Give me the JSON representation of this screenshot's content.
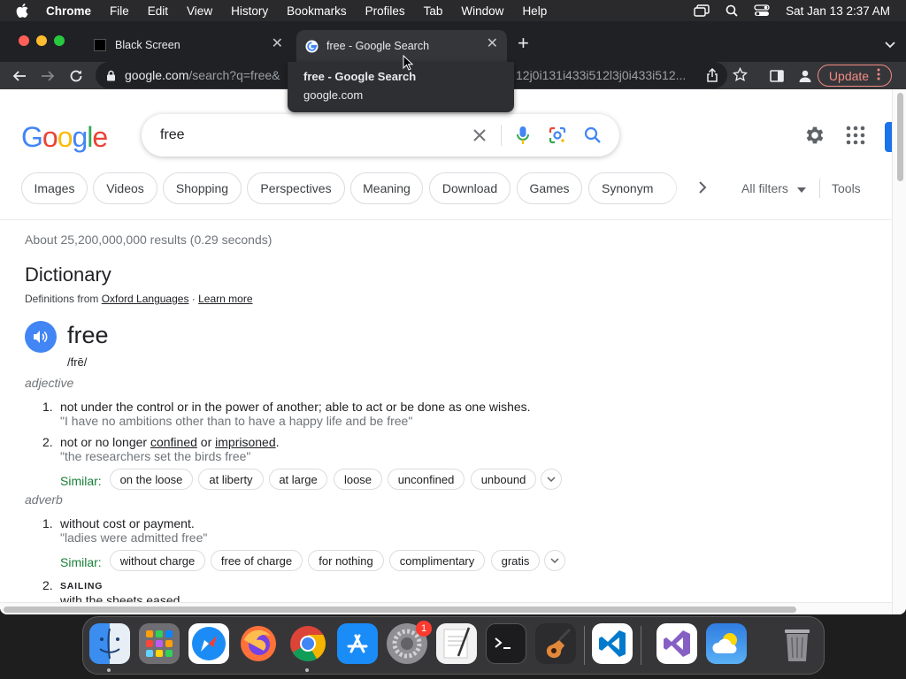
{
  "menubar": {
    "app": "Chrome",
    "items": [
      "File",
      "Edit",
      "View",
      "History",
      "Bookmarks",
      "Profiles",
      "Tab",
      "Window",
      "Help"
    ],
    "clock": "Sat Jan 13  2:37 AM"
  },
  "tabs": [
    {
      "title": "Black Screen",
      "active": false
    },
    {
      "title": "free - Google Search",
      "active": true
    }
  ],
  "toolbar": {
    "url_host": "google.com",
    "url_rest": "/search?q=free&",
    "url_tail": "12j0i131i433i512l3j0i433i512...",
    "update_label": "Update"
  },
  "tooltip": {
    "title": "free - Google Search",
    "domain": "google.com"
  },
  "search": {
    "query": "free"
  },
  "chips": [
    "Images",
    "Videos",
    "Shopping",
    "Perspectives",
    "Meaning",
    "Download",
    "Games",
    "Synonym"
  ],
  "filters": {
    "all_filters": "All filters",
    "tools": "Tools"
  },
  "results": {
    "stats": "About 25,200,000,000 results (0.29 seconds)"
  },
  "dictionary": {
    "heading": "Dictionary",
    "source_prefix": "Definitions from ",
    "source_link": "Oxford Languages",
    "separator": " · ",
    "learn_more": "Learn more",
    "word": "free",
    "phonetic": "/frē/",
    "adjective": {
      "pos": "adjective",
      "def1_num": "1.",
      "def1": "not under the control or in the power of another; able to act or be done as one wishes.",
      "def1_example": "\"I have no ambitions other than to have a happy life and be free\"",
      "def2_num": "2.",
      "def2_pre": "not or no longer ",
      "def2_link1": "confined",
      "def2_mid": " or ",
      "def2_link2": "imprisoned",
      "def2_post": ".",
      "def2_example": "\"the researchers set the birds free\"",
      "similar_label": "Similar:",
      "similar": [
        "on the loose",
        "at liberty",
        "at large",
        "loose",
        "unconfined",
        "unbound"
      ]
    },
    "adverb": {
      "pos": "adverb",
      "def1_num": "1.",
      "def1": "without cost or payment.",
      "def1_example": "\"ladies were admitted free\"",
      "similar_label": "Similar:",
      "similar": [
        "without charge",
        "free of charge",
        "for nothing",
        "complimentary",
        "gratis"
      ],
      "def2_num": "2.",
      "def2_label": "SAILING",
      "def2": "with the sheets eased."
    }
  },
  "dock": {
    "apps": [
      "finder-icon",
      "launchpad-icon",
      "safari-icon",
      "firefox-icon",
      "chrome-icon",
      "app-store-icon",
      "system-settings-icon",
      "textedit-icon",
      "terminal-icon",
      "garageband-icon",
      "vscode-icon",
      "visual-studio-icon",
      "weather-icon",
      "trash-icon"
    ],
    "settings_badge": "1"
  },
  "colors": {
    "accent": "#1a73e8",
    "similar_green": "#188038",
    "update_red": "#f28b82"
  }
}
